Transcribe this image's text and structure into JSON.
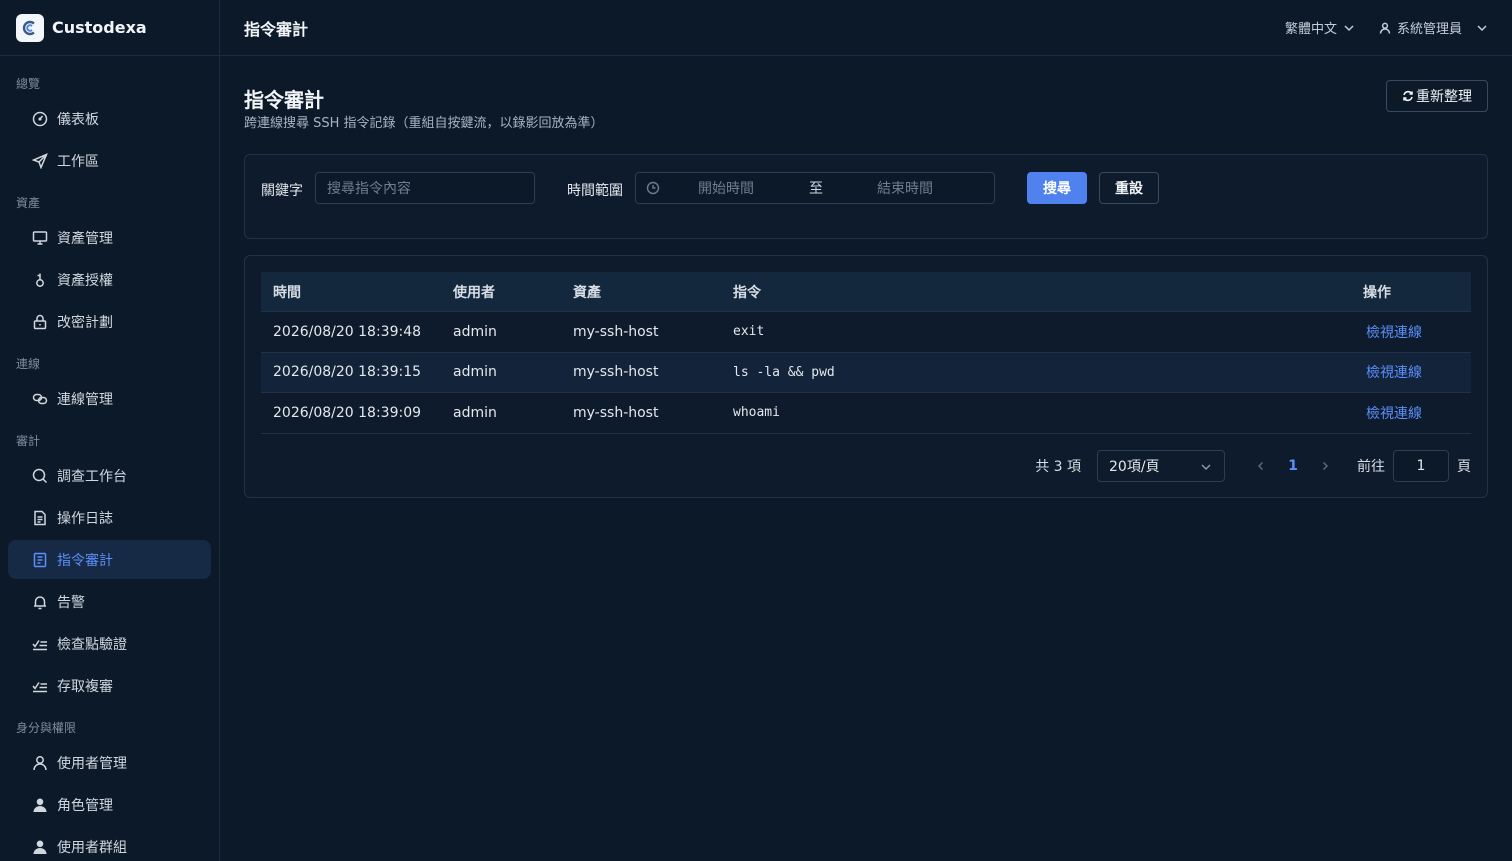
{
  "brand": {
    "name": "Custodexa"
  },
  "topbar": {
    "title": "指令審計",
    "language": "繁體中文",
    "user": "系統管理員"
  },
  "sidebar": {
    "groups": [
      {
        "label": "總覽",
        "items": [
          {
            "label": "儀表板",
            "icon": "dashboard-icon"
          },
          {
            "label": "工作區",
            "icon": "send-icon"
          }
        ]
      },
      {
        "label": "資產",
        "items": [
          {
            "label": "資產管理",
            "icon": "monitor-icon"
          },
          {
            "label": "資產授權",
            "icon": "key-icon"
          },
          {
            "label": "改密計劃",
            "icon": "lock-icon"
          }
        ]
      },
      {
        "label": "連線",
        "items": [
          {
            "label": "連線管理",
            "icon": "link-icon"
          }
        ]
      },
      {
        "label": "審計",
        "items": [
          {
            "label": "調查工作台",
            "icon": "search-icon"
          },
          {
            "label": "操作日誌",
            "icon": "document-icon"
          },
          {
            "label": "指令審計",
            "icon": "document-icon",
            "active": true
          },
          {
            "label": "告警",
            "icon": "bell-icon"
          },
          {
            "label": "檢查點驗證",
            "icon": "checklist-icon"
          },
          {
            "label": "存取複審",
            "icon": "checklist-icon"
          }
        ]
      },
      {
        "label": "身分與權限",
        "items": [
          {
            "label": "使用者管理",
            "icon": "user-icon"
          },
          {
            "label": "角色管理",
            "icon": "user-filled-icon"
          },
          {
            "label": "使用者群組",
            "icon": "user-filled-icon"
          }
        ]
      }
    ]
  },
  "page": {
    "title": "指令審計",
    "subtitle": "跨連線搜尋 SSH 指令記錄（重組自按鍵流，以錄影回放為準）",
    "refresh_label": "重新整理"
  },
  "filter": {
    "keyword_label": "關鍵字",
    "keyword_placeholder": "搜尋指令內容",
    "range_label": "時間範圍",
    "range_start_placeholder": "開始時間",
    "range_separator": "至",
    "range_end_placeholder": "結束時間",
    "search_label": "搜尋",
    "reset_label": "重設"
  },
  "table": {
    "columns": [
      "時間",
      "使用者",
      "資產",
      "指令",
      "操作"
    ],
    "rows": [
      {
        "time": "2026/08/20 18:39:48",
        "user": "admin",
        "asset": "my-ssh-host",
        "command": "exit",
        "action": "檢視連線"
      },
      {
        "time": "2026/08/20 18:39:15",
        "user": "admin",
        "asset": "my-ssh-host",
        "command": "ls -la && pwd",
        "action": "檢視連線"
      },
      {
        "time": "2026/08/20 18:39:09",
        "user": "admin",
        "asset": "my-ssh-host",
        "command": "whoami",
        "action": "檢視連線"
      }
    ]
  },
  "pagination": {
    "total": "共 3 項",
    "page_size": "20項/頁",
    "current_page": "1",
    "goto_label": "前往",
    "goto_value": "1",
    "unit": "頁"
  },
  "colors": {
    "accent": "#5b8ff9",
    "primary_button": "#4f82ee",
    "background": "#0c1929"
  }
}
